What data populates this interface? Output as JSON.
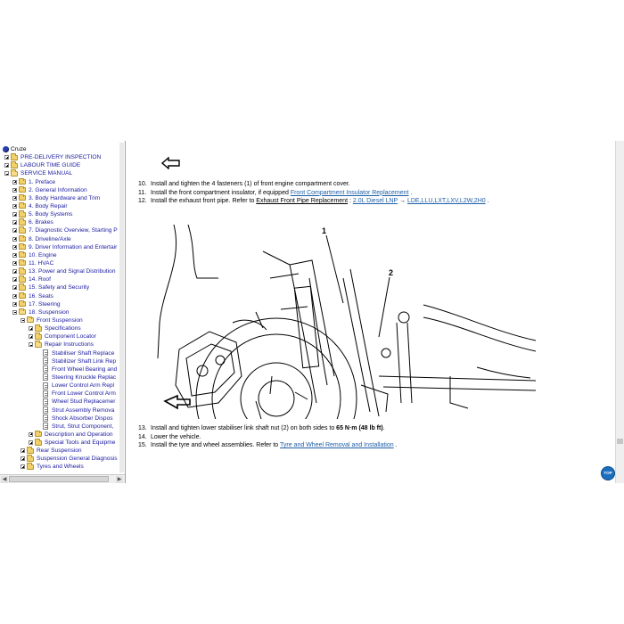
{
  "sidebar": {
    "items": [
      {
        "label": "Cruze",
        "level": 0,
        "icon": "root",
        "toggle": "none"
      },
      {
        "label": "PRE-DELIVERY INSPECTION",
        "level": 1,
        "icon": "folder",
        "toggle": "plus"
      },
      {
        "label": "LABOUR TIME GUIDE",
        "level": 1,
        "icon": "folder",
        "toggle": "plus"
      },
      {
        "label": "SERVICE MANUAL",
        "level": 1,
        "icon": "folder-open",
        "toggle": "minus"
      },
      {
        "label": "1. Preface",
        "level": 2,
        "icon": "folder",
        "toggle": "plus"
      },
      {
        "label": "2. General Information",
        "level": 2,
        "icon": "folder",
        "toggle": "plus"
      },
      {
        "label": "3. Body Hardware and Trim",
        "level": 2,
        "icon": "folder",
        "toggle": "plus"
      },
      {
        "label": "4. Body Repair",
        "level": 2,
        "icon": "folder",
        "toggle": "plus"
      },
      {
        "label": "5. Body Systems",
        "level": 2,
        "icon": "folder",
        "toggle": "plus"
      },
      {
        "label": "6. Brakes",
        "level": 2,
        "icon": "folder",
        "toggle": "plus"
      },
      {
        "label": "7. Diagnostic Overview, Starting P",
        "level": 2,
        "icon": "folder",
        "toggle": "plus"
      },
      {
        "label": "8. Driveline/Axle",
        "level": 2,
        "icon": "folder",
        "toggle": "plus"
      },
      {
        "label": "9. Driver Information and Entertair",
        "level": 2,
        "icon": "folder",
        "toggle": "plus"
      },
      {
        "label": "10. Engine",
        "level": 2,
        "icon": "folder",
        "toggle": "plus"
      },
      {
        "label": "11. HVAC",
        "level": 2,
        "icon": "folder",
        "toggle": "plus"
      },
      {
        "label": "13. Power and Signal Distribution",
        "level": 2,
        "icon": "folder",
        "toggle": "plus"
      },
      {
        "label": "14. Roof",
        "level": 2,
        "icon": "folder",
        "toggle": "plus"
      },
      {
        "label": "15. Safety and Security",
        "level": 2,
        "icon": "folder",
        "toggle": "plus"
      },
      {
        "label": "16. Seats",
        "level": 2,
        "icon": "folder",
        "toggle": "plus"
      },
      {
        "label": "17. Steering",
        "level": 2,
        "icon": "folder",
        "toggle": "plus"
      },
      {
        "label": "18. Suspension",
        "level": 2,
        "icon": "folder-open",
        "toggle": "minus"
      },
      {
        "label": "Front Suspension",
        "level": 3,
        "icon": "folder-open",
        "toggle": "minus"
      },
      {
        "label": "Specifications",
        "level": 4,
        "icon": "folder",
        "toggle": "plus"
      },
      {
        "label": "Component Locator",
        "level": 4,
        "icon": "folder",
        "toggle": "plus"
      },
      {
        "label": "Repair Instructions",
        "level": 4,
        "icon": "folder-open",
        "toggle": "minus"
      },
      {
        "label": "Stabiliser Shaft Replace",
        "level": 5,
        "icon": "doc",
        "toggle": "none"
      },
      {
        "label": "Stabilizer Shaft Link Rep",
        "level": 5,
        "icon": "doc",
        "toggle": "none"
      },
      {
        "label": "Front Wheel Bearing and",
        "level": 5,
        "icon": "doc",
        "toggle": "none"
      },
      {
        "label": "Steering Knuckle Replac",
        "level": 5,
        "icon": "doc",
        "toggle": "none"
      },
      {
        "label": "Lower Control Arm Repl",
        "level": 5,
        "icon": "doc",
        "toggle": "none"
      },
      {
        "label": "Front Lower Control Arm",
        "level": 5,
        "icon": "doc",
        "toggle": "none"
      },
      {
        "label": "Wheel Stud Replacemer",
        "level": 5,
        "icon": "doc",
        "toggle": "none"
      },
      {
        "label": "Strut Assembly Remova",
        "level": 5,
        "icon": "doc",
        "toggle": "none"
      },
      {
        "label": "Shock Absorber Dispos",
        "level": 5,
        "icon": "doc",
        "toggle": "none"
      },
      {
        "label": "Strut, Strut Component,",
        "level": 5,
        "icon": "doc",
        "toggle": "none"
      },
      {
        "label": "Description and Operation",
        "level": 4,
        "icon": "folder",
        "toggle": "plus"
      },
      {
        "label": "Special Tools and Equipme",
        "level": 4,
        "icon": "folder",
        "toggle": "plus"
      },
      {
        "label": "Rear Suspension",
        "level": 3,
        "icon": "folder",
        "toggle": "plus"
      },
      {
        "label": "Suspension General Diagnosis",
        "level": 3,
        "icon": "folder",
        "toggle": "plus"
      },
      {
        "label": "Tyres and Wheels",
        "level": 3,
        "icon": "folder",
        "toggle": "plus"
      }
    ]
  },
  "content": {
    "steps_top": [
      {
        "num": "10.",
        "text": "Install and tighten the 4 fasteners (1) of front engine compartment cover."
      },
      {
        "num": "11.",
        "text": "Install the front compartment insulator, if equipped ",
        "link": "Front Compartment Insulator Replacement",
        "after": " ."
      },
      {
        "num": "12.",
        "text": "Install the exhaust front pipe. Refer to ",
        "u1": "Exhaust Front Pipe Replacement",
        "mid": " : ",
        "link": "2.0L Diesel LNP",
        "arrow": " → ",
        "link2": "LDE,LLU,LXT,LXV,L2W,2H0",
        "after": " ."
      }
    ],
    "figure_labels": {
      "callout1": "1",
      "callout2": "2"
    },
    "steps_bottom": [
      {
        "num": "13.",
        "text": "Install and tighten lower stabiliser link shaft nut (2) on both sides to ",
        "bold": "65 N·m (48 lb ft)",
        "after": "."
      },
      {
        "num": "14.",
        "text": "Lower the vehicle."
      },
      {
        "num": "15.",
        "text": "Install the tyre and wheel assemblies. Refer to ",
        "link": "Tyre and Wheel Removal and Installation",
        "after": " ."
      }
    ],
    "top_button": "TOP"
  },
  "colors": {
    "link": "#1f5fa8",
    "tree_text": "#1a1aa0",
    "folder": "#f2d06a"
  }
}
